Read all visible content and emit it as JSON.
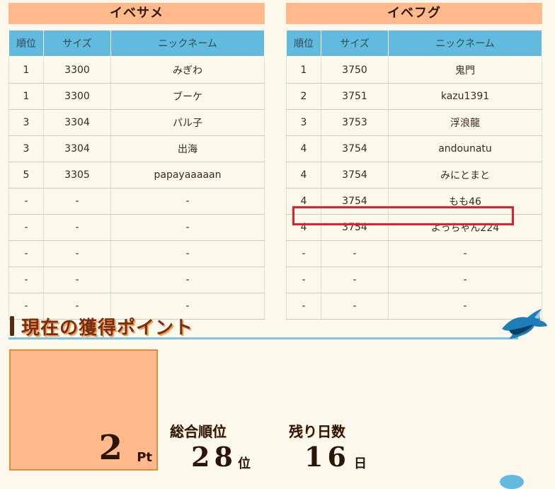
{
  "left_panel": {
    "title": "イベサメ",
    "headers": [
      "順位",
      "サイズ",
      "ニックネーム"
    ],
    "rows": [
      [
        "1",
        "3300",
        "みぎわ"
      ],
      [
        "1",
        "3300",
        "ブーケ"
      ],
      [
        "3",
        "3304",
        "パル子"
      ],
      [
        "3",
        "3304",
        "出海"
      ],
      [
        "5",
        "3305",
        "papayaaaaan"
      ],
      [
        "-",
        "-",
        "-"
      ],
      [
        "-",
        "-",
        "-"
      ],
      [
        "-",
        "-",
        "-"
      ],
      [
        "-",
        "-",
        "-"
      ],
      [
        "-",
        "-",
        "-"
      ]
    ]
  },
  "right_panel": {
    "title": "イベフグ",
    "headers": [
      "順位",
      "サイズ",
      "ニックネーム"
    ],
    "rows": [
      [
        "1",
        "3750",
        "鬼門"
      ],
      [
        "2",
        "3751",
        "kazu1391"
      ],
      [
        "3",
        "3753",
        "浮浪龍"
      ],
      [
        "4",
        "3754",
        "andounatu"
      ],
      [
        "4",
        "3754",
        "みにとまと"
      ],
      [
        "4",
        "3754",
        "もも46"
      ],
      [
        "4",
        "3754",
        "よっちゃん224"
      ],
      [
        "-",
        "-",
        "-"
      ],
      [
        "-",
        "-",
        "-"
      ],
      [
        "-",
        "-",
        "-"
      ]
    ],
    "highlighted_row_index": 6
  },
  "points_section": {
    "heading": "現在の獲得ポイント",
    "points_value": "2",
    "points_unit": "Pt",
    "overall_rank_label": "総合順位",
    "overall_rank_value": "28",
    "overall_rank_unit": "位",
    "days_left_label": "残り日数",
    "days_left_value": "16",
    "days_left_unit": "日"
  },
  "colors": {
    "title_bg": "#ffb98a",
    "header_bg": "#62bbdf",
    "page_bg": "#fdf8ec",
    "highlight": "#e0202a"
  }
}
